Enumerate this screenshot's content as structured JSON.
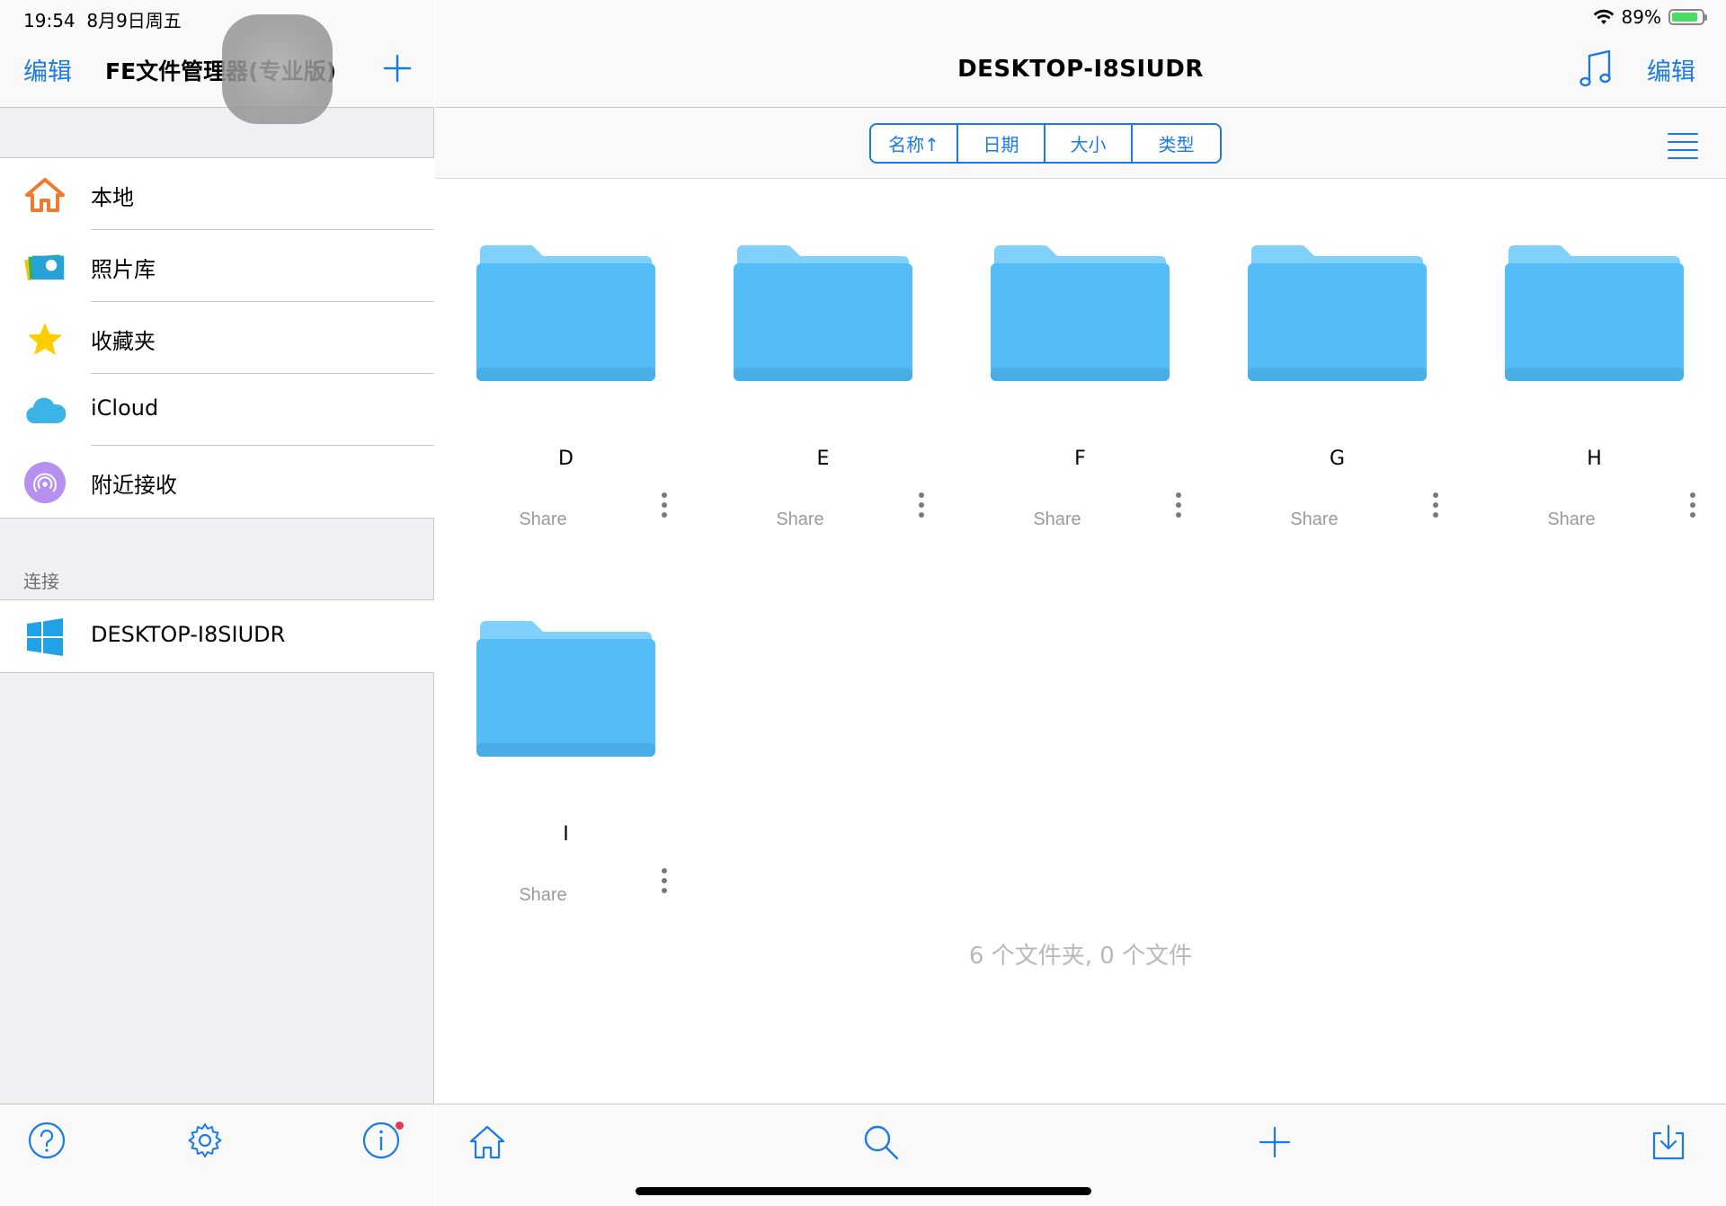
{
  "status_bar": {
    "time": "19:54",
    "date": "8月9日周五",
    "battery_percent": "89%",
    "battery_level": 0.89
  },
  "sidebar": {
    "edit_label": "编辑",
    "title": "FE文件管理器(专业版)",
    "items": [
      {
        "label": "本地",
        "icon": "house-icon"
      },
      {
        "label": "照片库",
        "icon": "photos-icon"
      },
      {
        "label": "收藏夹",
        "icon": "star-icon"
      },
      {
        "label": "iCloud",
        "icon": "cloud-icon"
      },
      {
        "label": "附近接收",
        "icon": "airdrop-icon"
      }
    ],
    "connections_header": "连接",
    "connections": [
      {
        "label": "DESKTOP-I8SIUDR",
        "icon": "windows-icon"
      }
    ],
    "toolbar": [
      "help-icon",
      "settings-icon",
      "info-icon"
    ]
  },
  "main": {
    "title": "DESKTOP-I8SIUDR",
    "edit_label": "编辑",
    "sort_options": [
      "名称↑",
      "日期",
      "大小",
      "类型"
    ],
    "folders": [
      {
        "name": "D",
        "sub": "Share"
      },
      {
        "name": "E",
        "sub": "Share"
      },
      {
        "name": "F",
        "sub": "Share"
      },
      {
        "name": "G",
        "sub": "Share"
      },
      {
        "name": "H",
        "sub": "Share"
      },
      {
        "name": "I",
        "sub": "Share"
      }
    ],
    "summary": "6 个文件夹, 0 个文件",
    "toolbar": [
      "home-icon",
      "search-icon",
      "plus-icon",
      "download-icon"
    ]
  },
  "colors": {
    "accent": "#1b7ae6",
    "folder": "#55bdf5",
    "folder_tab": "#7fd0fb",
    "sidebar_bg": "#efeff4"
  }
}
